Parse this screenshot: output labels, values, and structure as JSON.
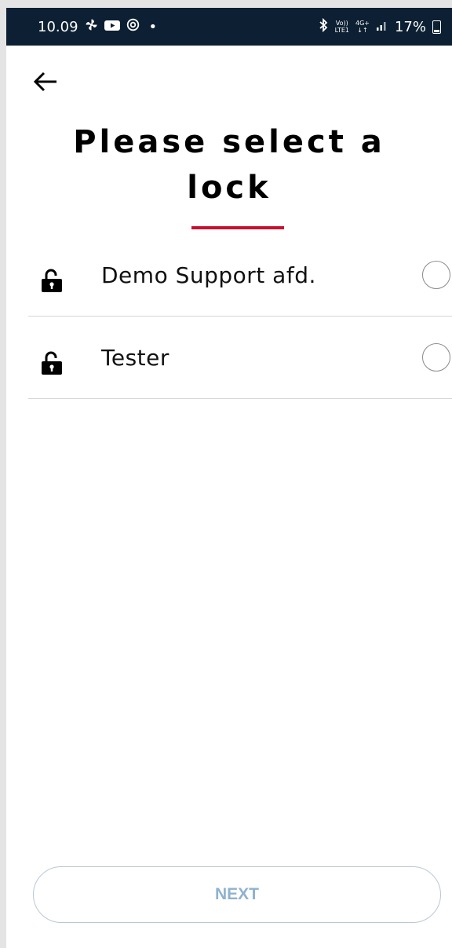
{
  "status_bar": {
    "time": "10.09",
    "notification_icons": [
      "pinwheel-icon",
      "youtube-icon",
      "target-icon"
    ],
    "dot": "•",
    "network_top": "Vo))",
    "network_bottom": "LTE1",
    "network_type_top": "4G+",
    "network_type_bottom": "↓↑",
    "battery": "17%"
  },
  "header": {
    "back_icon": "arrow-left-icon",
    "title": "Please select a lock",
    "underline_color": "#c8102e"
  },
  "locks": [
    {
      "name": "Demo Support afd.",
      "icon": "unlocked-padlock-icon",
      "selected": false
    },
    {
      "name": "Tester",
      "icon": "unlocked-padlock-icon",
      "selected": false
    }
  ],
  "footer": {
    "next_label": "NEXT",
    "next_enabled": false
  },
  "colors": {
    "status_bar_bg": "#0c1f33",
    "accent": "#c8102e",
    "button_text_disabled": "#8fb2cf"
  }
}
